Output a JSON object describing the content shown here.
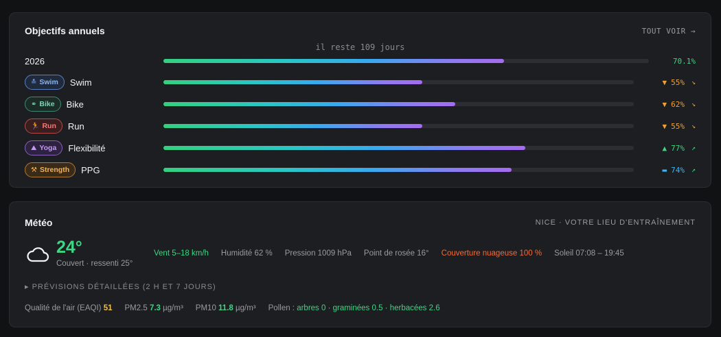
{
  "goals": {
    "title": "Objectifs annuels",
    "link": "TOUT VOIR →",
    "remaining": "il reste 109 jours",
    "year_row": {
      "label": "2026",
      "progress": 0.701,
      "pct": "70.1%"
    },
    "rows": [
      {
        "badge": "Swim",
        "badge_icon": "≛",
        "label": "Swim",
        "progress": 0.55,
        "indicator": "▼",
        "pct": "55%",
        "trend": "↘",
        "status": "behind"
      },
      {
        "badge": "Bike",
        "badge_icon": "⚭",
        "label": "Bike",
        "progress": 0.62,
        "indicator": "▼",
        "pct": "62%",
        "trend": "↘",
        "status": "behind"
      },
      {
        "badge": "Run",
        "badge_icon": "🏃",
        "label": "Run",
        "progress": 0.55,
        "indicator": "▼",
        "pct": "55%",
        "trend": "↘",
        "status": "behind"
      },
      {
        "badge": "Yoga",
        "badge_icon": "⛰",
        "label": "Flexibilité",
        "progress": 0.77,
        "indicator": "▲",
        "pct": "77%",
        "trend": "↗",
        "status": "ahead"
      },
      {
        "badge": "Strength",
        "badge_icon": "⚒",
        "label": "PPG",
        "progress": 0.74,
        "indicator": "▬",
        "pct": "74%",
        "trend": "↗",
        "status": "on-track"
      }
    ],
    "badge_colors": {
      "Swim": {
        "text": "#8ab4f8",
        "border": "#5b7fc4",
        "bg": "#1f2a3d"
      },
      "Bike": {
        "text": "#7fd1b2",
        "border": "#3f8b74",
        "bg": "#1b2c27"
      },
      "Run": {
        "text": "#f07a7a",
        "border": "#b34b4b",
        "bg": "#3a1e1f"
      },
      "Yoga": {
        "text": "#c39af0",
        "border": "#8662b8",
        "bg": "#2d2340"
      },
      "Strength": {
        "text": "#f0b45e",
        "border": "#b07a34",
        "bg": "#3a2a18"
      }
    },
    "status_colors": {
      "behind": "#f0a030",
      "ahead": "#3dd683",
      "on-track": "#38b7f0"
    },
    "trend_color": "#f0a030",
    "trend_up_color": "#3dd683"
  },
  "meteo": {
    "title": "Météo",
    "location": "NICE · VOTRE LIEU D'ENTRAÎNEMENT",
    "weather_icon": "cloud-icon",
    "temp": "24°",
    "condition": "Couvert · ressenti 25°",
    "wind": "Vent 5–18 km/h",
    "humidity": "Humidité 62 %",
    "pressure": "Pression 1009 hPa",
    "dew": "Point de rosée 16°",
    "cloud": "Couverture nuageuse 100 %",
    "sun": "Soleil 07:08 – 19:45",
    "forecast": "▸ PRÉVISIONS DÉTAILLÉES (2 H ET 7 JOURS)",
    "air": {
      "eaqi_label": "Qualité de l'air (EAQI)",
      "eaqi_value": "51",
      "pm25_label": "PM2.5",
      "pm25_value": "7.3",
      "pm25_unit": "µg/m³",
      "pm10_label": "PM10",
      "pm10_value": "11.8",
      "pm10_unit": "µg/m³",
      "pollen_label": "Pollen :",
      "pollen_value": "arbres 0 · graminées 0.5 · herbacées 2.6"
    }
  }
}
